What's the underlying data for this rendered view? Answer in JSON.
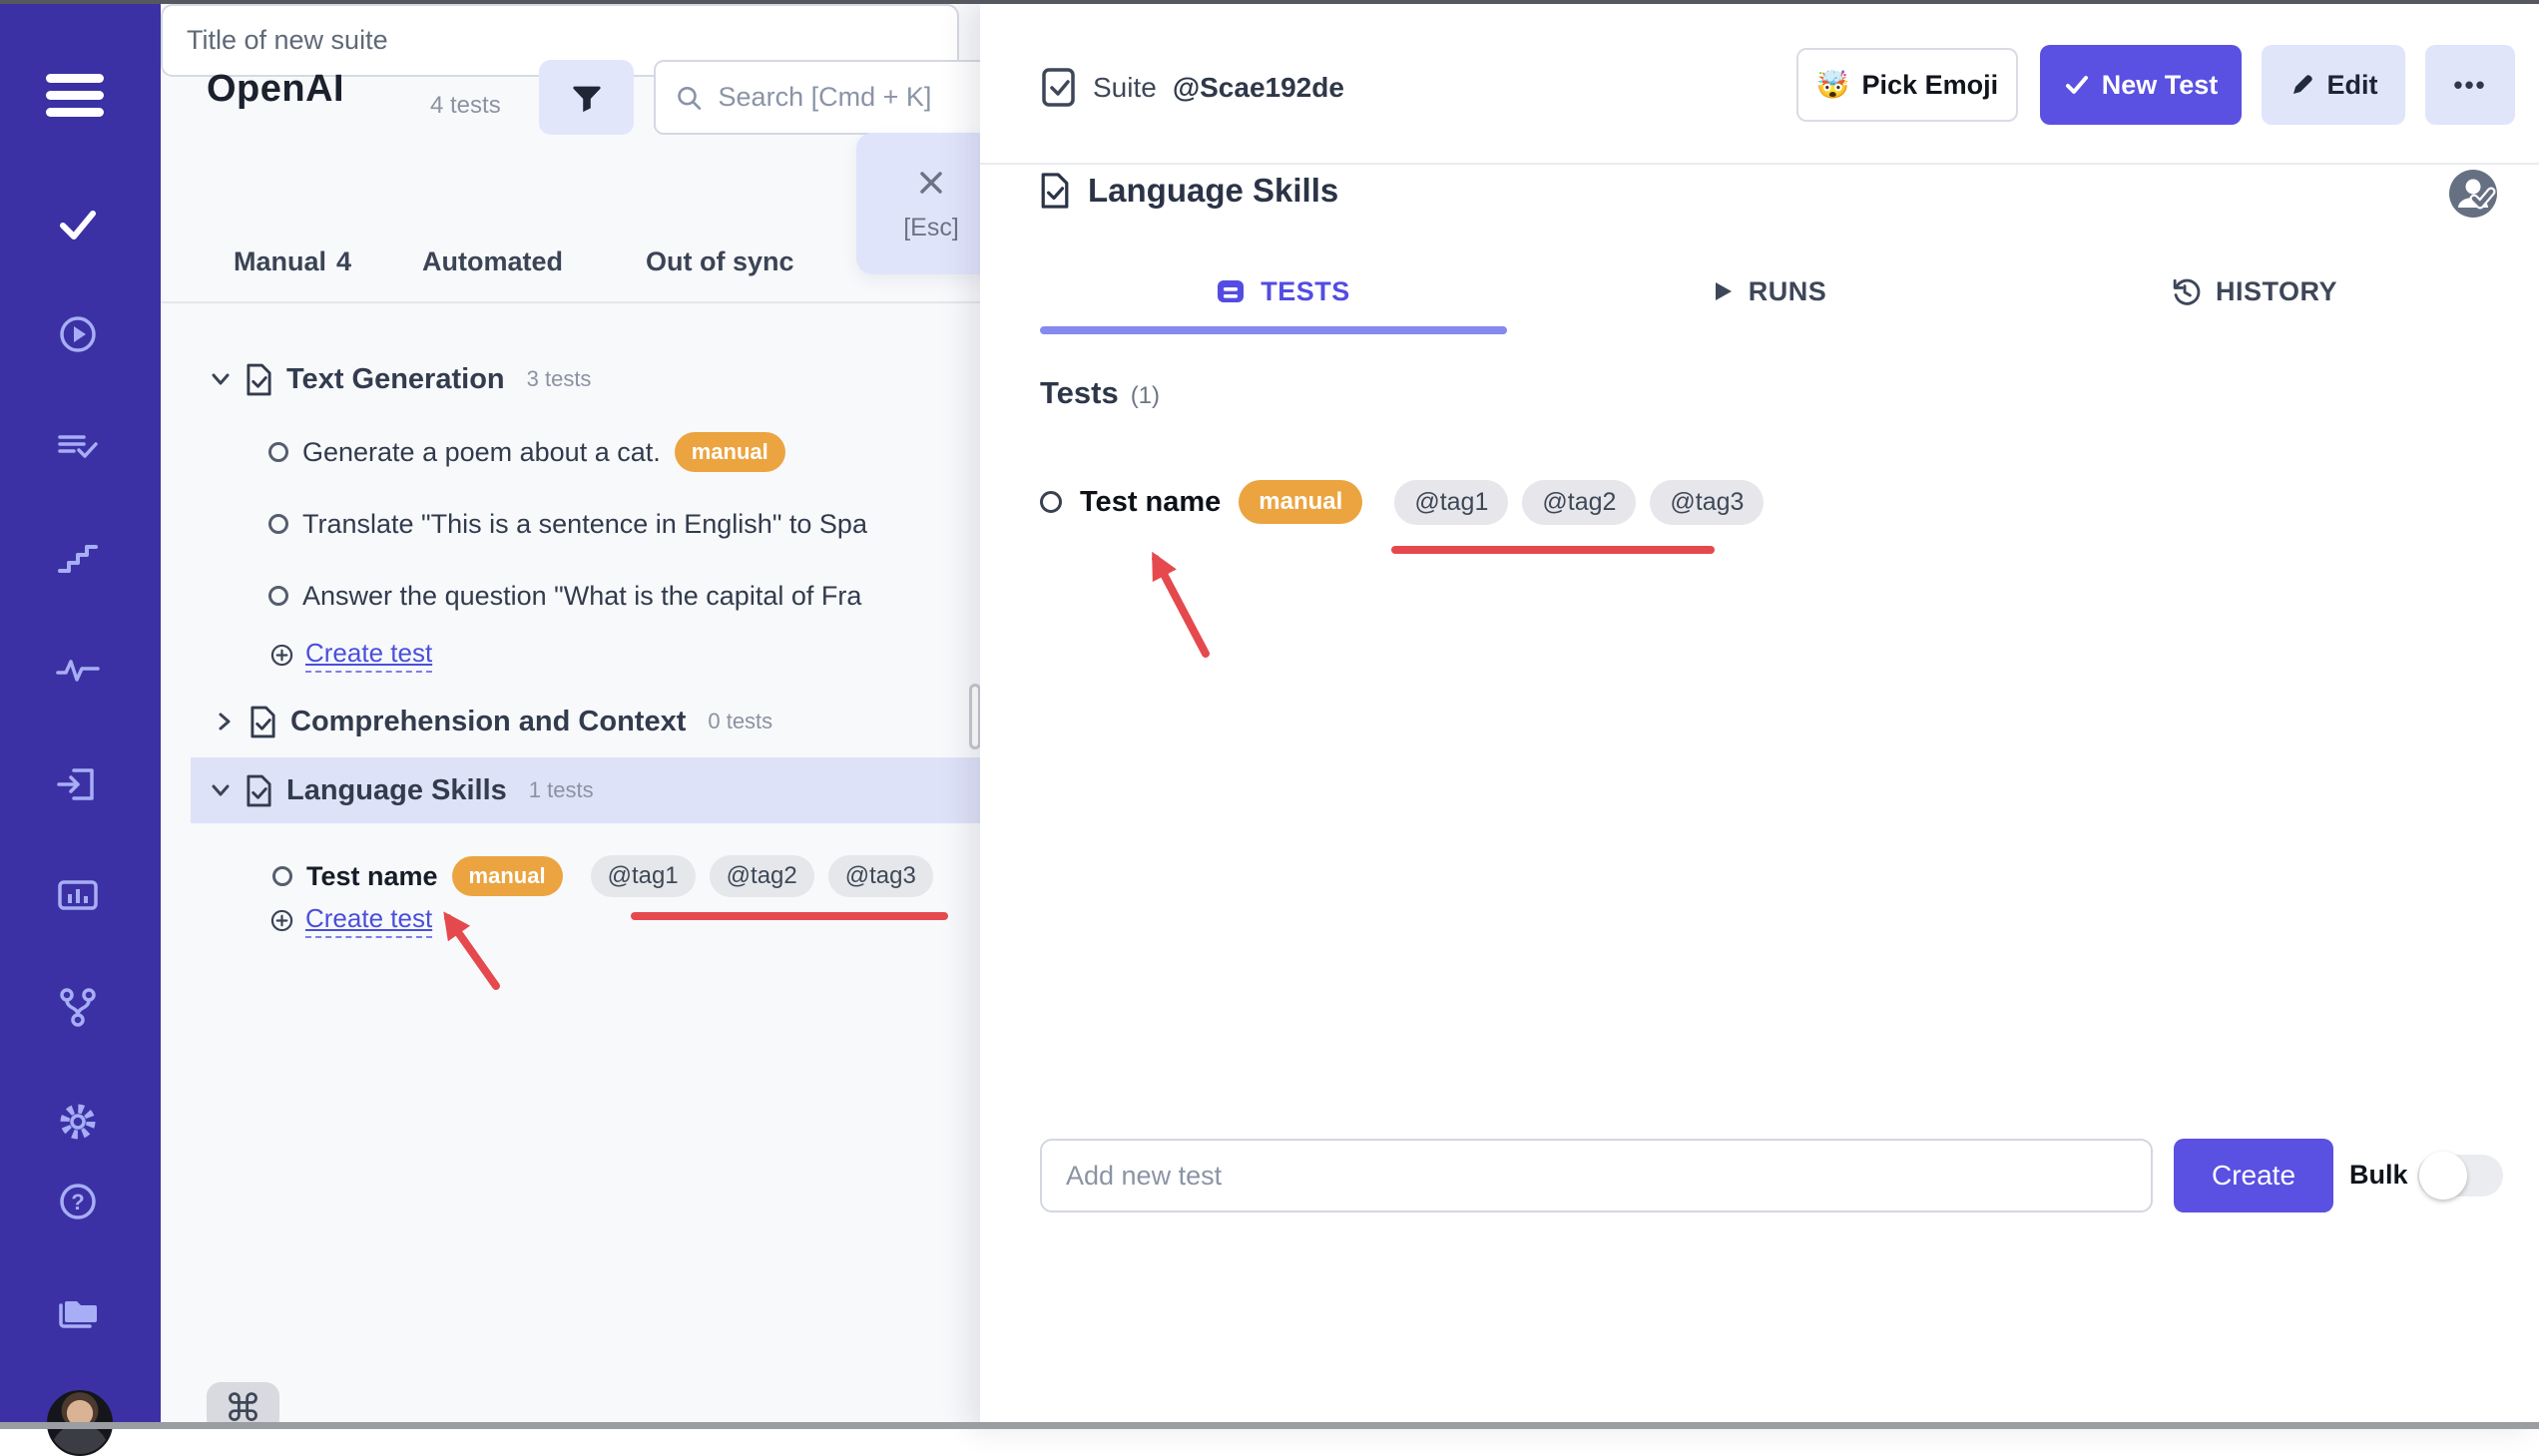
{
  "colors": {
    "accent_indigo": "#5a50e2",
    "sidebar_bg": "#3b31a5",
    "selected_row_bg": "#dee2f8",
    "badge_orange": "#eca440",
    "tag_gray_bg": "#e6e7ea",
    "annotation_red": "#e5494d",
    "link_indigo": "#4a4fdc",
    "tab_underline": "#8589f0"
  },
  "sidebar": {
    "icons": [
      "menu",
      "check",
      "play-circle",
      "list-check",
      "steps",
      "activity",
      "import",
      "bar-chart",
      "git-branch",
      "settings-gear",
      "help-circle",
      "folder",
      "user-avatar"
    ]
  },
  "left_panel": {
    "title": "OpenAI",
    "tests_count": "4 tests",
    "search_placeholder": "Search [Cmd + K]",
    "esc_hint": "[Esc]",
    "tabs": [
      {
        "label": "Manual",
        "count": "4"
      },
      {
        "label": "Automated",
        "count": ""
      },
      {
        "label": "Out of sync",
        "count": ""
      }
    ],
    "tree": {
      "suite1": {
        "label": "Text Generation",
        "count": "3 tests"
      },
      "test1": {
        "label": "Generate a poem about a cat.",
        "badge": "manual"
      },
      "test2": {
        "label": "Translate \"This is a sentence in English\" to Spa"
      },
      "test3": {
        "label": "Answer the question \"What is the capital of Fra"
      },
      "create1": "Create test",
      "suite2": {
        "label": "Comprehension and Context",
        "count": "0 tests"
      },
      "suite3": {
        "label": "Language Skills",
        "count": "1 tests"
      },
      "test4": {
        "label": "Test name",
        "badge": "manual",
        "tags": [
          "@tag1",
          "@tag2",
          "@tag3"
        ]
      },
      "create2": "Create test"
    },
    "new_suite_placeholder": "Title of new suite",
    "command_glyph": "⌘"
  },
  "right_panel": {
    "header": {
      "suite_label": "Suite",
      "suite_id": "@Scae192de",
      "pick_emoji_icon": "🤯",
      "pick_emoji": "Pick Emoji",
      "new_test": "New Test",
      "edit": "Edit",
      "more": "•••"
    },
    "title": "Language Skills",
    "tabs": [
      {
        "label": "TESTS"
      },
      {
        "label": "RUNS"
      },
      {
        "label": "HISTORY"
      }
    ],
    "tests_heading": "Tests",
    "tests_count": "(1)",
    "test": {
      "name": "Test name",
      "badge": "manual",
      "tags": [
        "@tag1",
        "@tag2",
        "@tag3"
      ]
    },
    "add_test_placeholder": "Add new test",
    "create_label": "Create",
    "bulk_label": "Bulk"
  }
}
